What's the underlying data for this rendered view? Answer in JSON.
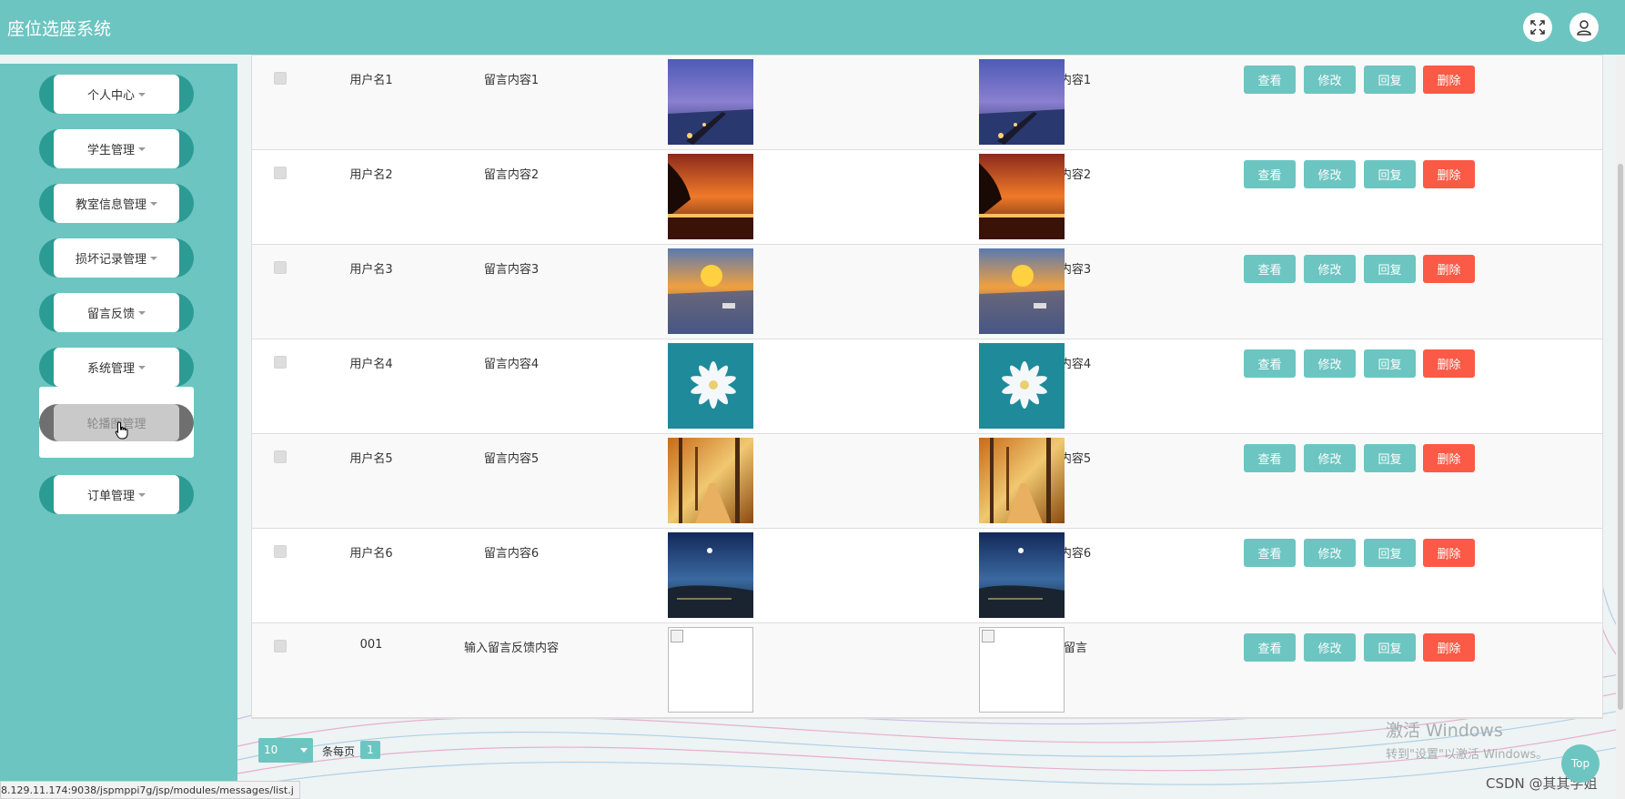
{
  "app": {
    "title": "座位选座系统"
  },
  "header": {
    "fullscreen_icon": "expand-icon",
    "user_icon": "user-icon"
  },
  "sidebar": {
    "items": [
      {
        "label": "个人中心"
      },
      {
        "label": "学生管理"
      },
      {
        "label": "教室信息管理"
      },
      {
        "label": "损坏记录管理"
      },
      {
        "label": "留言反馈"
      },
      {
        "label": "系统管理"
      },
      {
        "label": "订单管理"
      }
    ],
    "submenu": {
      "label": "轮播图管理"
    }
  },
  "table": {
    "actions": {
      "view": "查看",
      "edit": "修改",
      "reply": "回复",
      "delete": "删除"
    },
    "rows": [
      {
        "user": "用户名1",
        "message": "留言内容1",
        "reply": "回复内容1",
        "image": "pier-night"
      },
      {
        "user": "用户名2",
        "message": "留言内容2",
        "reply": "回复内容2",
        "image": "sunset-tree"
      },
      {
        "user": "用户名3",
        "message": "留言内容3",
        "reply": "回复内容3",
        "image": "sunset-river"
      },
      {
        "user": "用户名4",
        "message": "留言内容4",
        "reply": "回复内容4",
        "image": "white-flower"
      },
      {
        "user": "用户名5",
        "message": "留言内容5",
        "reply": "回复内容5",
        "image": "autumn-forest"
      },
      {
        "user": "用户名6",
        "message": "留言内容6",
        "reply": "回复内容6",
        "image": "night-city"
      },
      {
        "user": "001",
        "message": "输入留言反馈内容",
        "reply": "回复留言",
        "image": "broken"
      }
    ]
  },
  "pager": {
    "page_size": "10",
    "per_page_label": "条每页",
    "current_page": "1"
  },
  "status_url": "8.129.11.174:9038/jspmppi7g/jsp/modules/messages/list.j",
  "watermark": {
    "line1": "激活 Windows",
    "line2": "转到\"设置\"以激活 Windows。"
  },
  "csdn": "CSDN @其其学姐",
  "top_button": "Top",
  "colors": {
    "primary": "#6cc5c1",
    "sidebar_dark": "#2c9b94",
    "danger": "#fa5a46"
  }
}
